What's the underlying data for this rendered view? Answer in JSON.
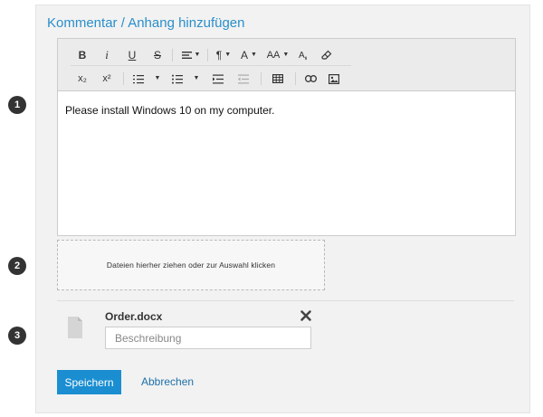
{
  "panel": {
    "title": "Kommentar / Anhang hinzufügen"
  },
  "markers": [
    "1",
    "2",
    "3"
  ],
  "toolbar": {
    "row1": [
      {
        "name": "bold-button",
        "label": "B"
      },
      {
        "name": "italic-button",
        "label": "i"
      },
      {
        "name": "underline-button",
        "label": "U"
      },
      {
        "name": "strikethrough-button",
        "label": "S"
      },
      {
        "name": "align-dropdown",
        "icon": "align-icon"
      },
      {
        "name": "paragraph-dropdown",
        "label": "¶"
      },
      {
        "name": "font-family-dropdown",
        "label": "A"
      },
      {
        "name": "font-size-dropdown",
        "label": "AA"
      },
      {
        "name": "text-color-button",
        "icon": "text-color-icon"
      },
      {
        "name": "clear-format-button",
        "icon": "eraser-icon"
      }
    ],
    "row2": [
      {
        "name": "subscript-button",
        "label": "x₂"
      },
      {
        "name": "superscript-button",
        "label": "x²"
      },
      {
        "name": "ordered-list-dropdown",
        "icon": "ordered-list-icon"
      },
      {
        "name": "unordered-list-dropdown",
        "icon": "unordered-list-icon"
      },
      {
        "name": "indent-button",
        "icon": "indent-icon"
      },
      {
        "name": "outdent-button",
        "icon": "outdent-icon"
      },
      {
        "name": "table-button",
        "icon": "table-icon"
      },
      {
        "name": "link-button",
        "icon": "link-icon"
      },
      {
        "name": "image-button",
        "icon": "image-icon"
      }
    ]
  },
  "editor": {
    "content": "Please install Windows 10 on my computer."
  },
  "dropzone": {
    "label": "Dateien hierher ziehen oder zur Auswahl klicken"
  },
  "attachment": {
    "file_name": "Order.docx",
    "file_icon": "document-icon",
    "remove_icon": "close-icon",
    "description_placeholder": "Beschreibung"
  },
  "actions": {
    "save": "Speichern",
    "cancel": "Abbrechen"
  },
  "colors": {
    "accent": "#1a8ed1",
    "title": "#2a8fcb",
    "link": "#1d70a8"
  }
}
